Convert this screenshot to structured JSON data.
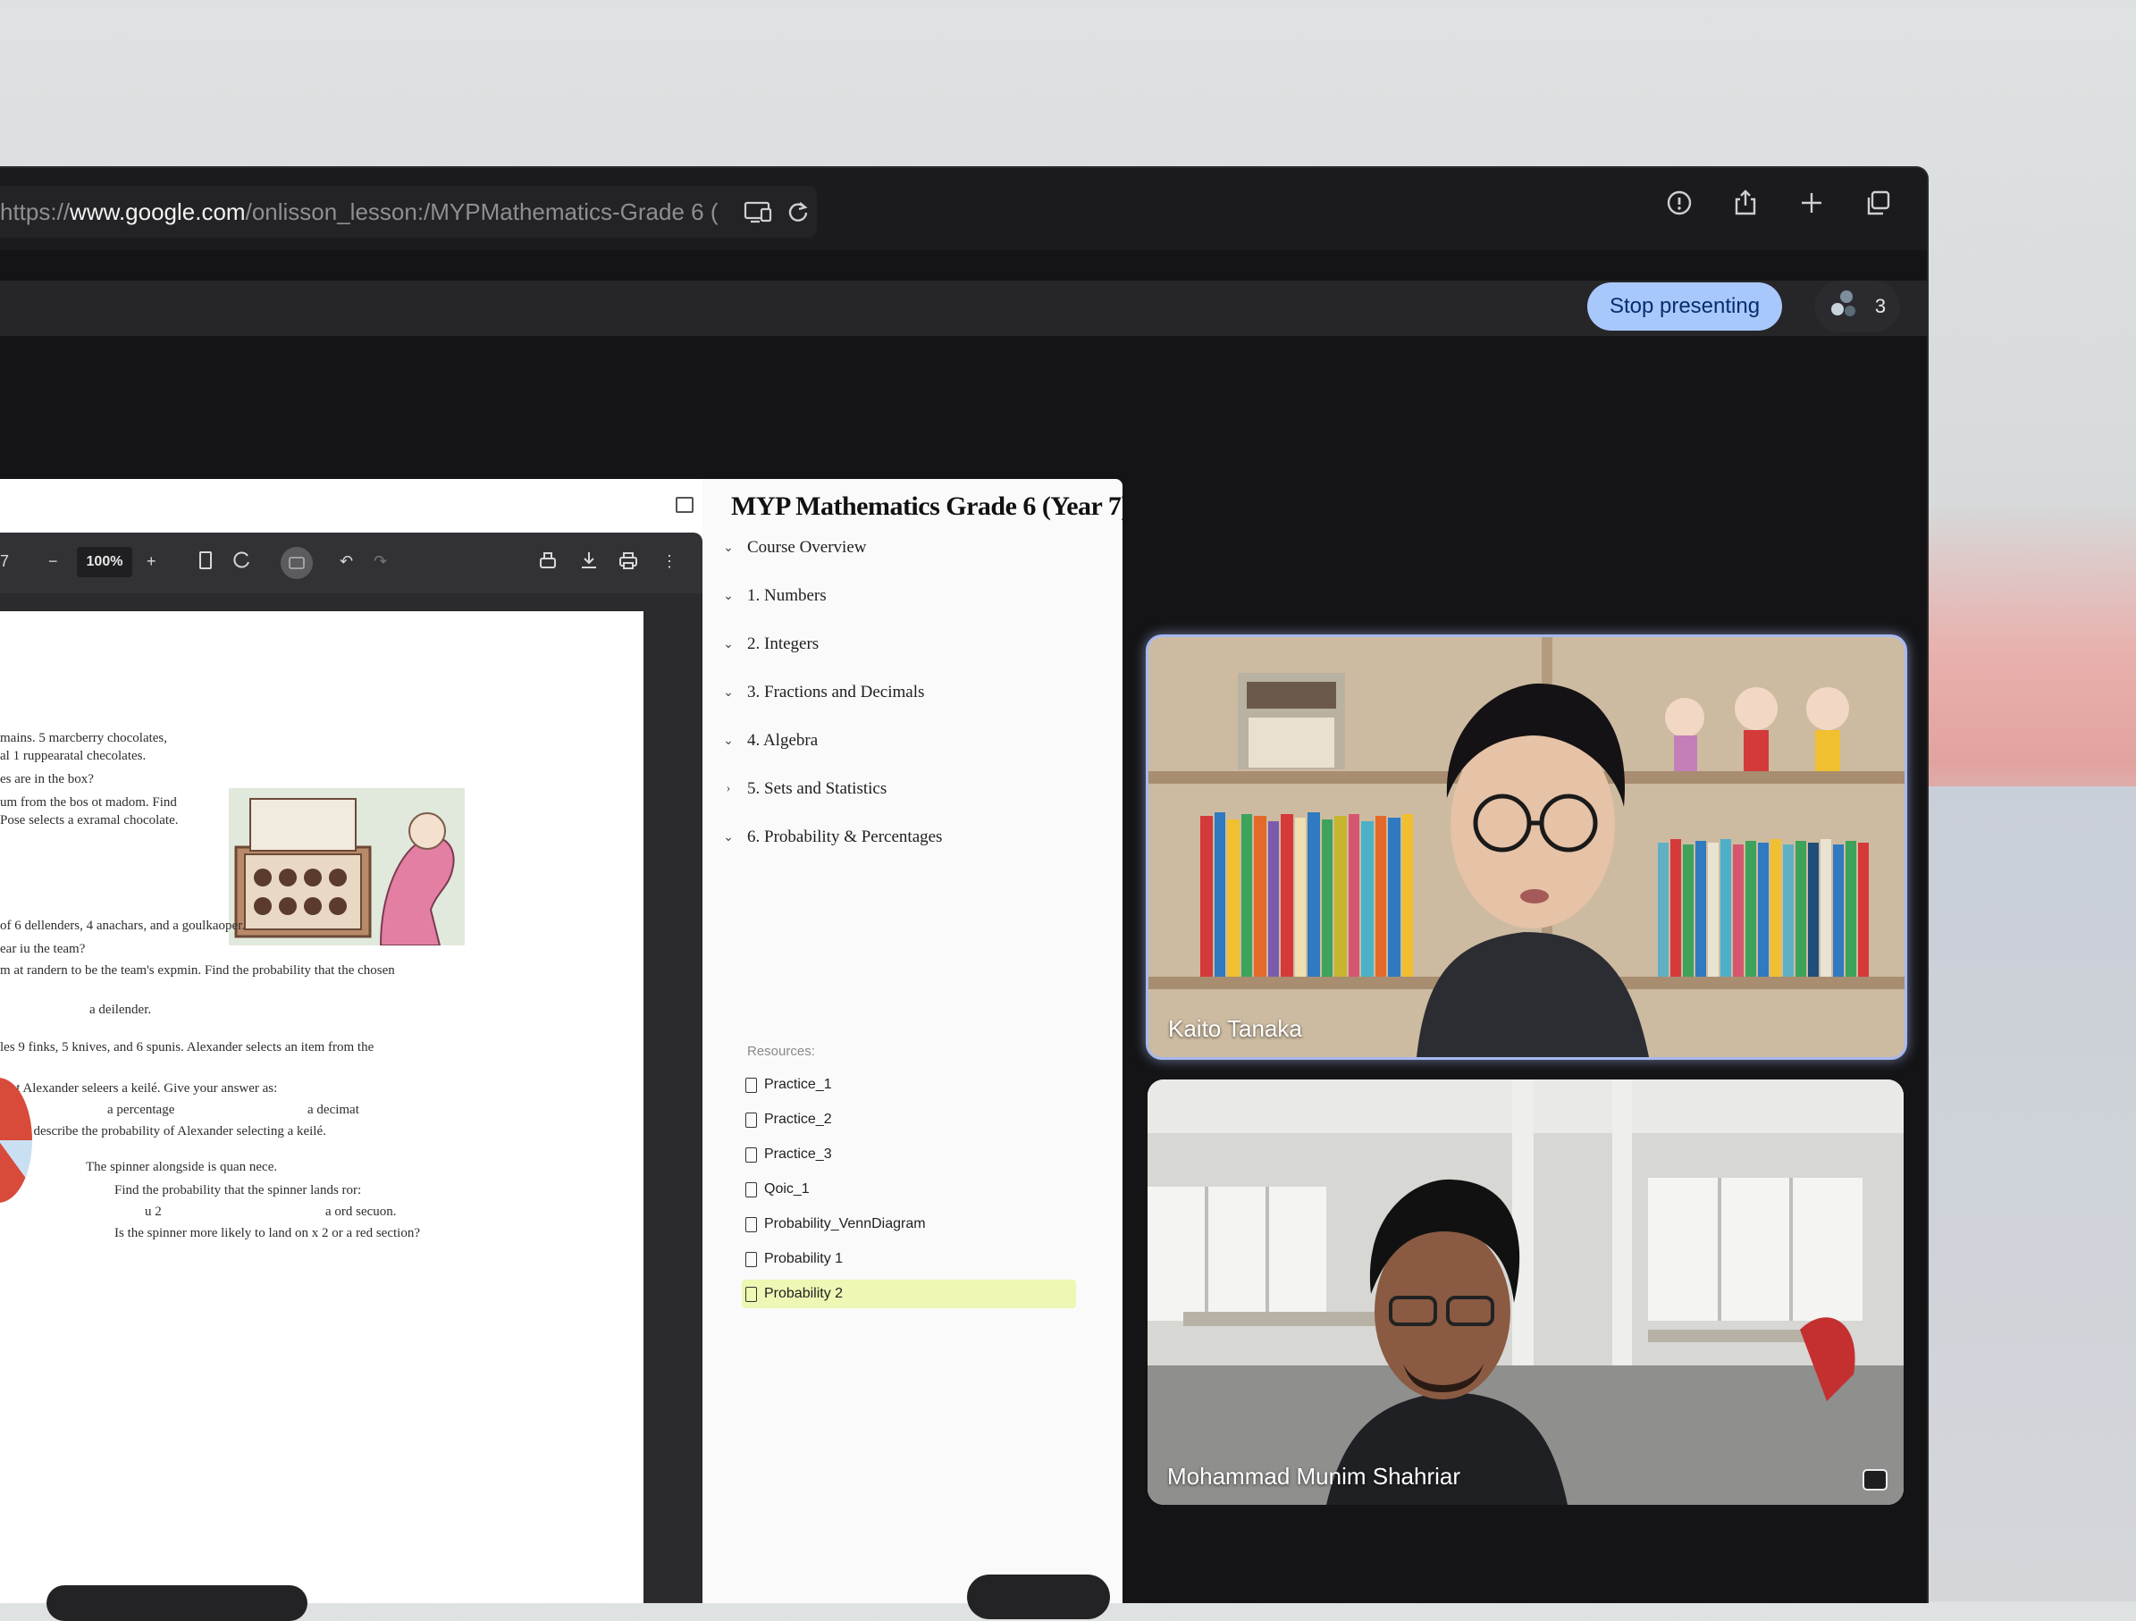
{
  "browser": {
    "url_prefix": "https://",
    "url_host": "www.google.com",
    "url_path": "/onlisson_lesson:/MYPMathematics-Grade 6 (",
    "icons": [
      "cast-icon",
      "reload-icon",
      "info-icon",
      "share-icon",
      "new-tab-icon",
      "tabs-icon"
    ]
  },
  "meet": {
    "stop_presenting_label": "Stop presenting",
    "participants_count": "3"
  },
  "pdf": {
    "page_indicator": "7",
    "zoom": "100%",
    "lines": [
      "mains. 5 marcberry chocolates,",
      "al 1 ruppearatal checolates.",
      "es are in the box?",
      "um from the bos ot madom. Find",
      "Pose selects a exramal chocolate.",
      "of 6 dellenders, 4 anachars, and a goulkaoper.",
      "ear iu the team?",
      "m at randern to be the team's expmin. Find the probability that the chosen",
      "a deilender.",
      "les 9 finks, 5 knives, and 6 spunis.  Alexander selects an item from the",
      "that Alexander seleers a keilé. Give your answer as:",
      "a percentage",
      "a decimat",
      "ant to describe the probability of Alexander selecting a keilé.",
      "The spinner alongside is quan nece.",
      "Find the probability that the spinner lands ror:",
      "u 2",
      "a ord secuon.",
      "Is the spinner more likely to land on x 2 or a red section?"
    ]
  },
  "outline": {
    "title": "MYP Mathematics Grade 6 (Year 7)",
    "sections": [
      {
        "label": "Course Overview",
        "chevron": "⌄"
      },
      {
        "label": "1. Numbers",
        "chevron": "⌄"
      },
      {
        "label": "2. Integers",
        "chevron": "⌄"
      },
      {
        "label": "3. Fractions and Decimals",
        "chevron": "⌄"
      },
      {
        "label": "4. Algebra",
        "chevron": "⌄"
      },
      {
        "label": "5. Sets and Statistics",
        "chevron": "›"
      },
      {
        "label": "6. Probability & Percentages",
        "chevron": "⌄"
      }
    ],
    "resources_label": "Resources:",
    "files": [
      "Practice_1",
      "Practice_2",
      "Practice_3",
      "Qoic_1",
      "Probability_VennDiagram",
      "Probability 1",
      "Probability 2"
    ],
    "active_file": "Probability 2"
  },
  "participants": [
    {
      "name": "Kaito Tanaka"
    },
    {
      "name": "Mohammad Munim Shahriar"
    }
  ],
  "colors": {
    "stop_btn_bg": "#a8c7fa",
    "active_file_bg": "#eef7b3",
    "speaker_border": "#a7b9f1"
  }
}
